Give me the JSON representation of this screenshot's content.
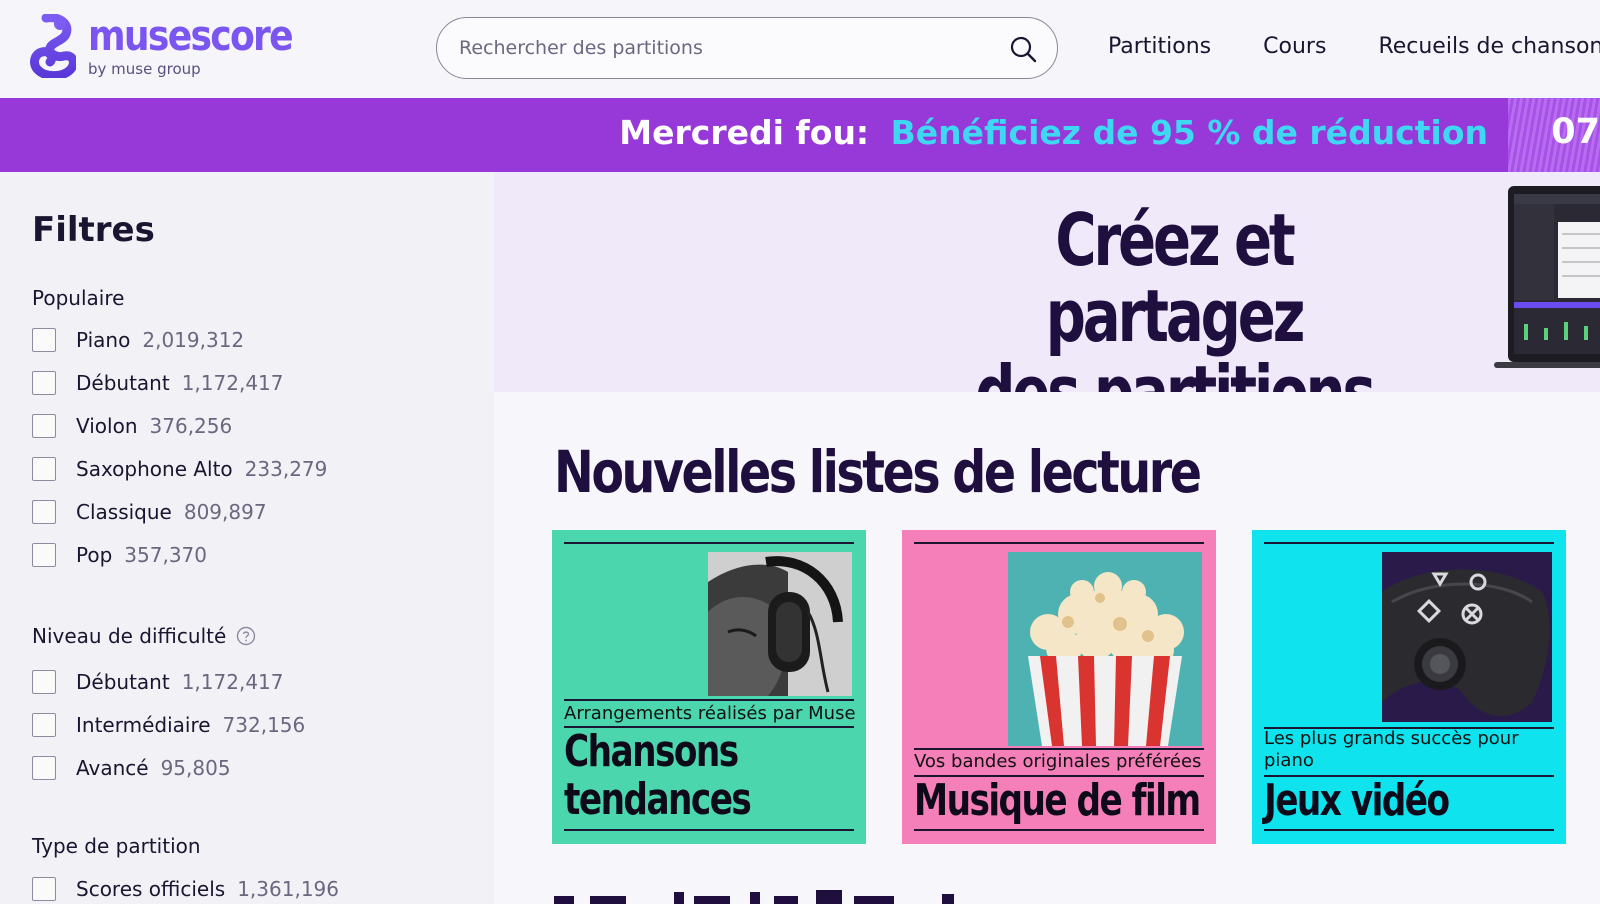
{
  "header": {
    "logo_word": "musescore",
    "logo_sub": "by muse group",
    "search_placeholder": "Rechercher des partitions",
    "nav": [
      "Partitions",
      "Cours",
      "Recueils de chansons"
    ]
  },
  "promo": {
    "lead": "Mercredi fou:",
    "offer": "Bénéficiez de 95 % de réduction",
    "countdown": "07"
  },
  "sidebar": {
    "title": "Filtres",
    "groups": [
      {
        "title": "Populaire",
        "items": [
          {
            "label": "Piano",
            "count": "2,019,312"
          },
          {
            "label": "Débutant",
            "count": "1,172,417"
          },
          {
            "label": "Violon",
            "count": "376,256"
          },
          {
            "label": "Saxophone Alto",
            "count": "233,279"
          },
          {
            "label": "Classique",
            "count": "809,897"
          },
          {
            "label": "Pop",
            "count": "357,370"
          }
        ]
      },
      {
        "title": "Niveau de difficulté",
        "items": [
          {
            "label": "Débutant",
            "count": "1,172,417"
          },
          {
            "label": "Intermédiaire",
            "count": "732,156"
          },
          {
            "label": "Avancé",
            "count": "95,805"
          }
        ]
      },
      {
        "title": "Type de partition",
        "items": [
          {
            "label": "Scores officiels",
            "count": "1,361,196"
          }
        ]
      }
    ]
  },
  "hero": {
    "title_line1": "Créez et partagez",
    "title_line2": "des partitions"
  },
  "main": {
    "section_title": "Nouvelles listes de lecture",
    "cards": [
      {
        "subtitle": "Arrangements réalisés par Muse",
        "title_line1": "Chansons",
        "title_line2": "tendances",
        "color": "#4cd6ad",
        "icon": "headphones-photo"
      },
      {
        "subtitle": "Vos bandes originales préférées",
        "title_line1": "Musique de film",
        "title_line2": "",
        "color": "#f57fb8",
        "icon": "popcorn-photo"
      },
      {
        "subtitle": "Les plus grands succès pour piano",
        "title_line1": "Jeux vidéo",
        "title_line2": "",
        "color": "#0ee3ee",
        "icon": "gamepad-photo"
      }
    ]
  },
  "colors": {
    "brand": "#7a55f0",
    "promo_bg": "#9739d8",
    "promo_offer": "#3fd8f2",
    "hero_bg": "#efe9fa",
    "title_dark": "#1e0f3f"
  }
}
